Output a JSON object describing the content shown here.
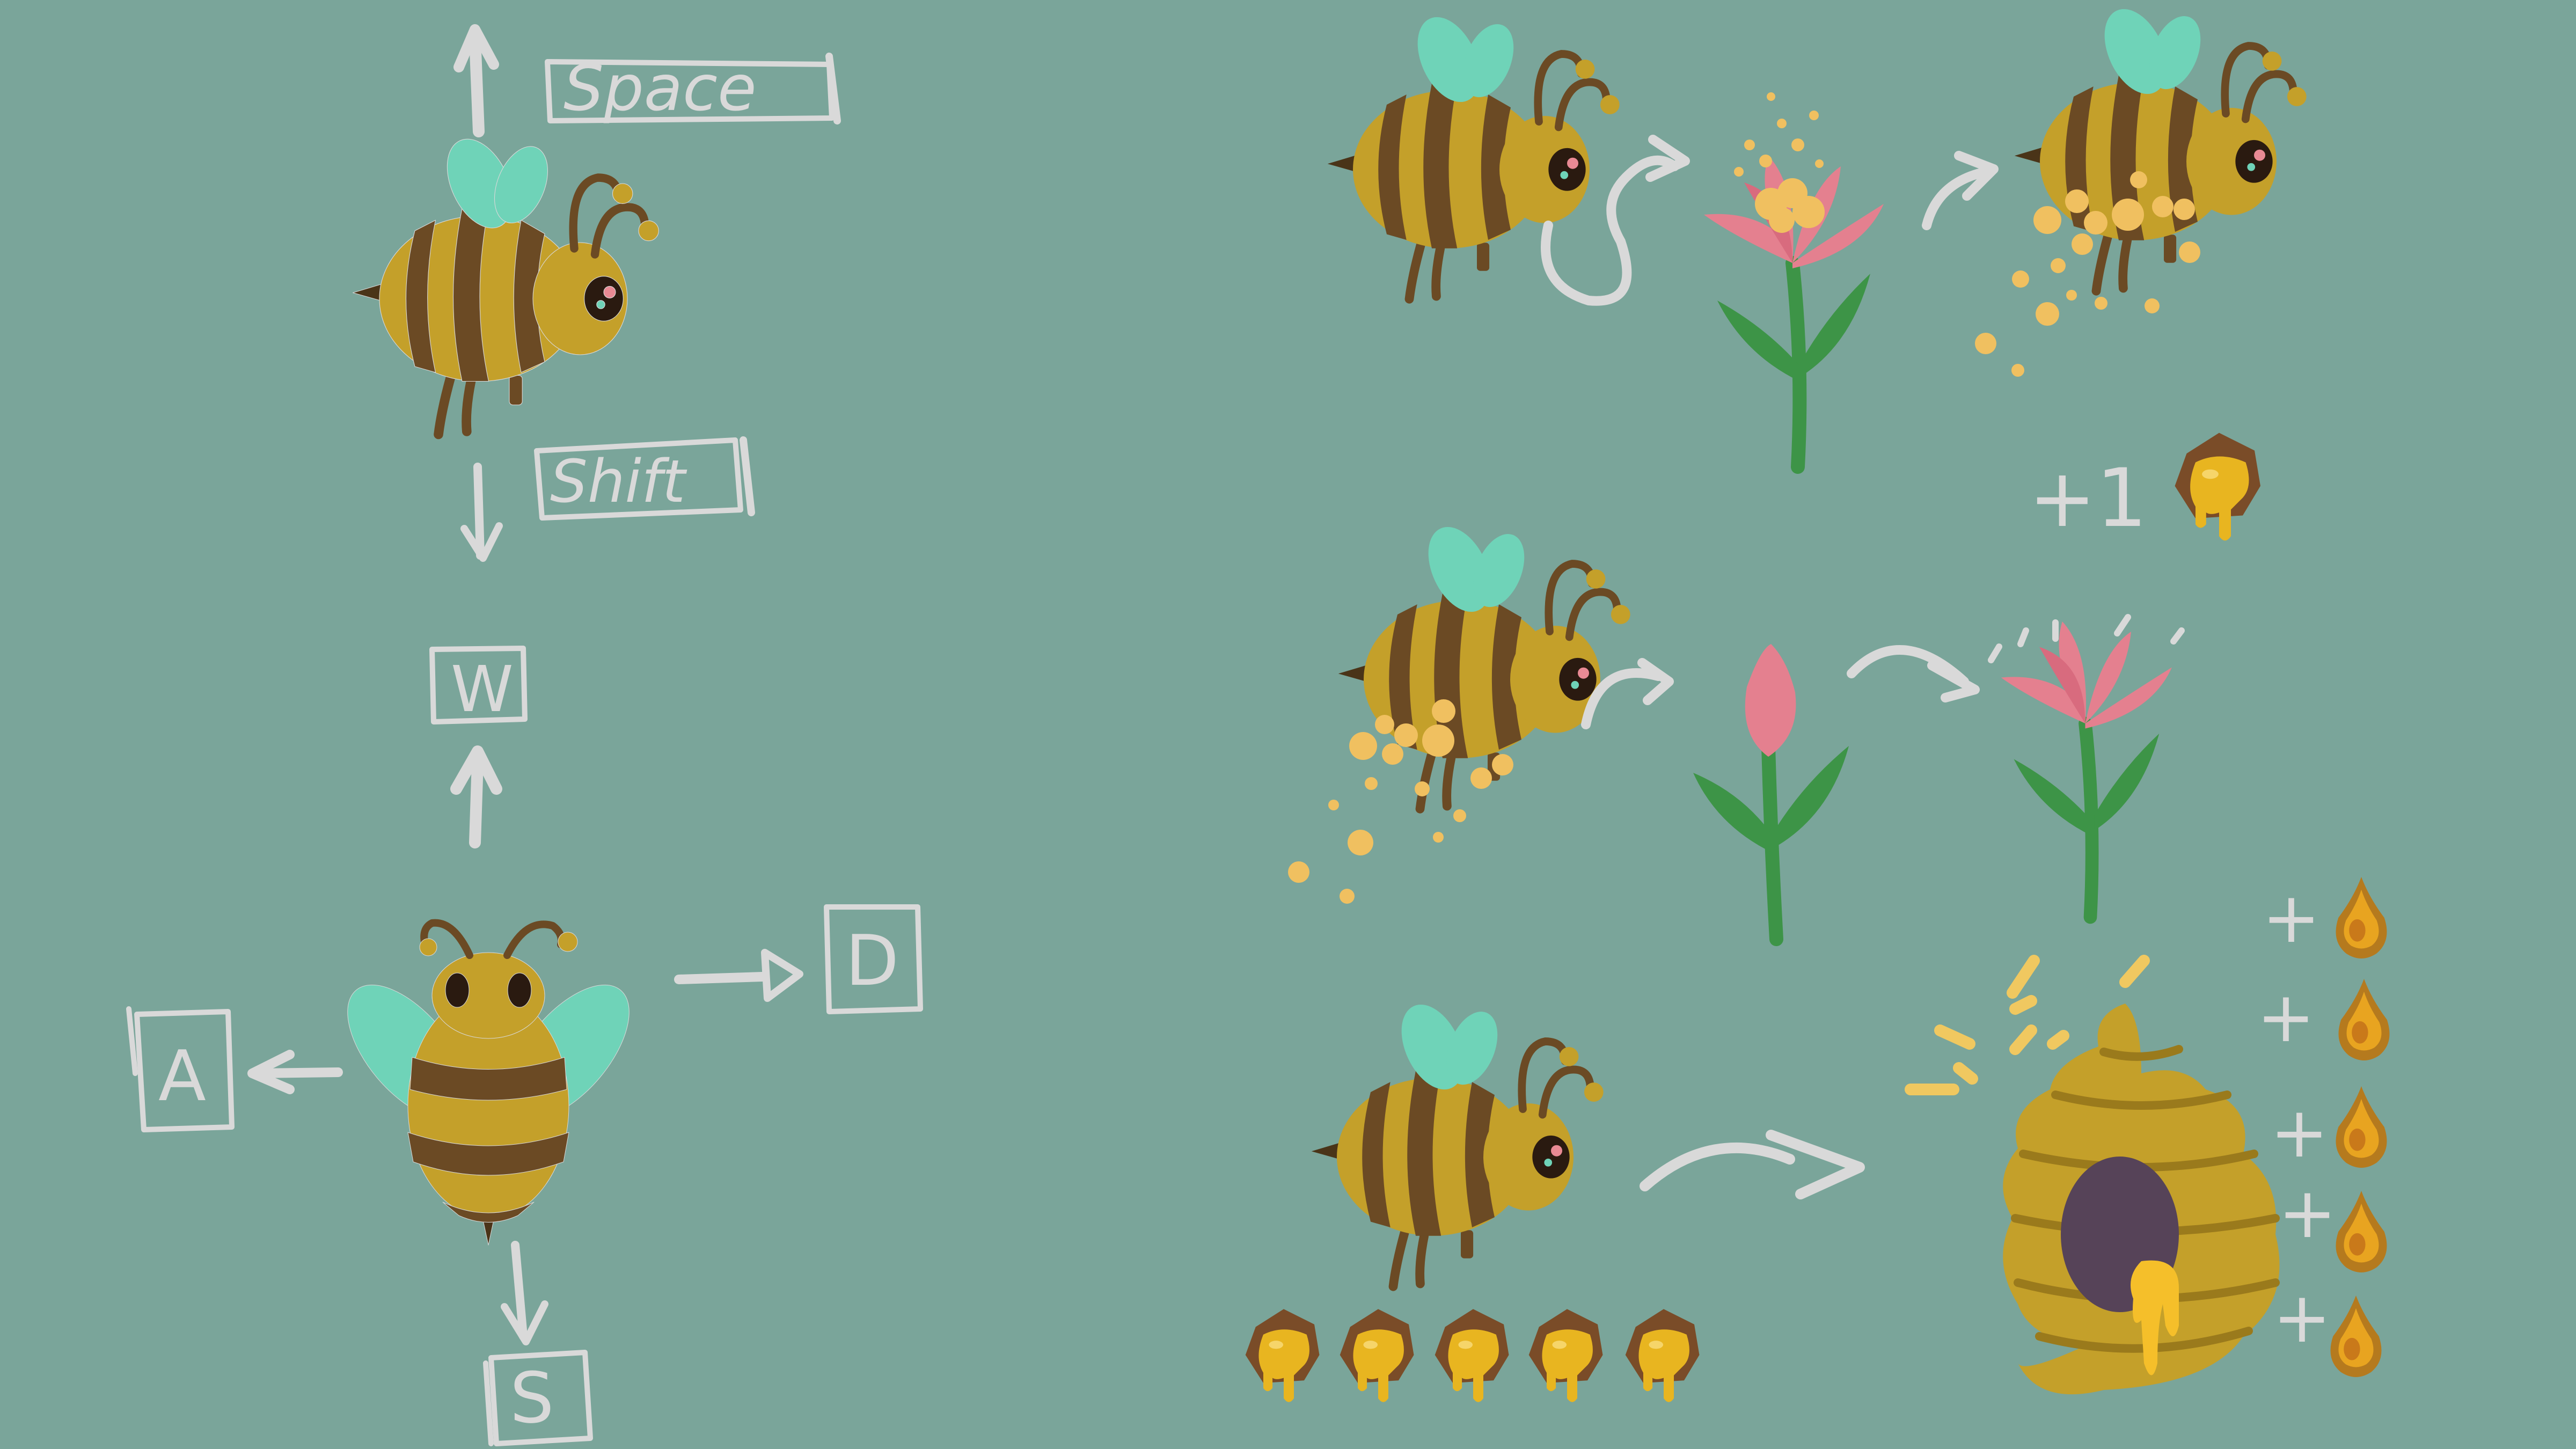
{
  "controls": {
    "ascend_key": "Space",
    "descend_key": "Shift",
    "forward_key": "W",
    "left_key": "A",
    "right_key": "D",
    "back_key": "S"
  },
  "rewards": {
    "pollen_gain_label": "+1",
    "honey_bonus_labels": [
      "+",
      "+",
      "+",
      "+",
      "+"
    ]
  },
  "inventory": {
    "honey_slots": 5
  },
  "colors": {
    "background": "#7aa59a",
    "chalk": "#d9d9d9",
    "bee_body": "#c4a02a",
    "bee_stripe": "#6b4a24",
    "wing": "#6fd3b8",
    "pollen": "#f0c060",
    "petal": "#e4808f",
    "stem": "#3d9447",
    "hive": "#c4a02a",
    "hive_hole": "#564358",
    "honey": "#e8b520"
  }
}
